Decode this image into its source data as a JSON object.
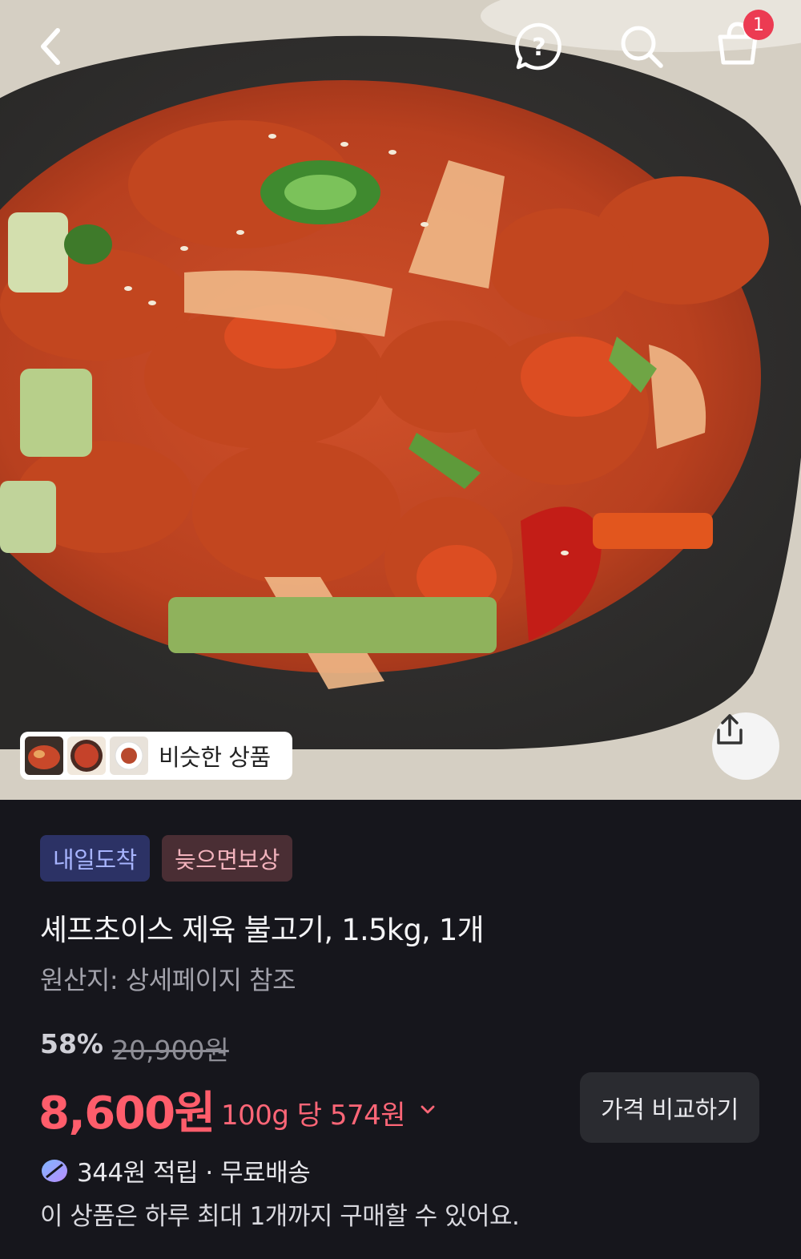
{
  "header": {
    "back_icon": "chevron-left-icon",
    "help_icon": "question-bubble-icon",
    "search_icon": "search-icon",
    "cart_icon": "shopping-bag-icon",
    "cart_badge": "1"
  },
  "hero": {
    "similar_products_label": "비슷한 상품",
    "share_icon": "share-icon"
  },
  "product": {
    "tags": {
      "arrival": "내일도착",
      "late_compensation": "늦으면보상"
    },
    "title": "셰프초이스 제육 불고기, 1.5kg, 1개",
    "origin": "원산지: 상세페이지 참조",
    "discount_rate": "58%",
    "original_price": "20,900원",
    "sale_price": "8,600원",
    "unit_price": "100g 당 574원",
    "compare_button": "가격 비교하기",
    "reward_text": "344원 적립 · 무료배송",
    "purchase_limit": "이 상품은 하루 최대 1개까지 구매할 수 있어요."
  },
  "colors": {
    "background": "#16161c",
    "accent_price": "#ff5d6b",
    "badge": "#ec3b52"
  }
}
